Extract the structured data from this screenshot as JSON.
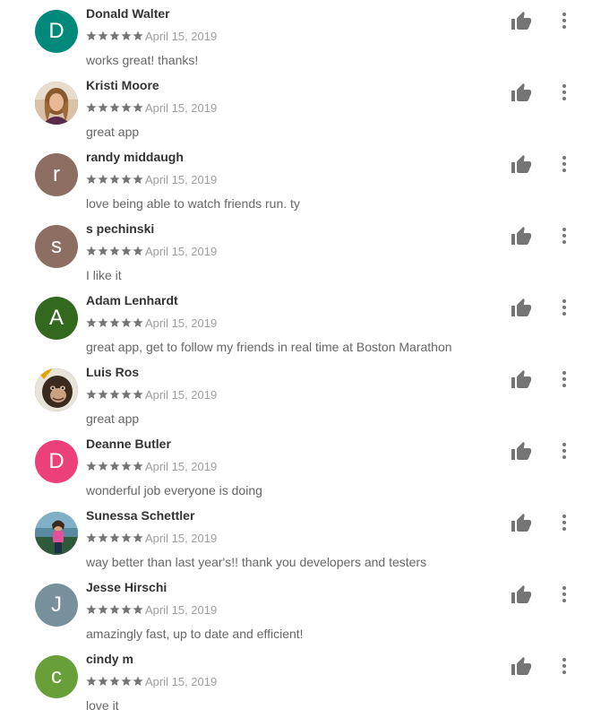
{
  "reviews": [
    {
      "name": "Donald Walter",
      "initial": "D",
      "avatar_color": "#00897b",
      "avatar_type": "initial",
      "date": "April 15, 2019",
      "rating": 5,
      "text": "works great! thanks!"
    },
    {
      "name": "Kristi Moore",
      "initial": "",
      "avatar_color": "#7b4a2d",
      "avatar_type": "photo",
      "date": "April 15, 2019",
      "rating": 5,
      "text": "great app"
    },
    {
      "name": "randy middaugh",
      "initial": "r",
      "avatar_color": "#8d6e63",
      "avatar_type": "initial",
      "date": "April 15, 2019",
      "rating": 5,
      "text": "love being able to watch friends run. ty"
    },
    {
      "name": "s pechinski",
      "initial": "s",
      "avatar_color": "#8d6e63",
      "avatar_type": "initial",
      "date": "April 15, 2019",
      "rating": 5,
      "text": "I like it"
    },
    {
      "name": "Adam Lenhardt",
      "initial": "A",
      "avatar_color": "#33691e",
      "avatar_type": "initial",
      "date": "April 15, 2019",
      "rating": 5,
      "text": "great app, get to follow my friends in real time at Boston Marathon"
    },
    {
      "name": "Luis Ros",
      "initial": "",
      "avatar_color": "#5d4037",
      "avatar_type": "photo",
      "date": "April 15, 2019",
      "rating": 5,
      "text": "great app"
    },
    {
      "name": "Deanne Butler",
      "initial": "D",
      "avatar_color": "#ec407a",
      "avatar_type": "initial",
      "date": "April 15, 2019",
      "rating": 5,
      "text": "wonderful job everyone is doing"
    },
    {
      "name": "Sunessa Schettler",
      "initial": "",
      "avatar_color": "#3f6e8c",
      "avatar_type": "photo",
      "date": "April 15, 2019",
      "rating": 5,
      "text": "way better than last year's!! thank you developers and testers"
    },
    {
      "name": "Jesse Hirschi",
      "initial": "J",
      "avatar_color": "#78909c",
      "avatar_type": "initial",
      "date": "April 15, 2019",
      "rating": 5,
      "text": "amazingly fast, up to date and efficient!"
    },
    {
      "name": "cindy m",
      "initial": "c",
      "avatar_color": "#689f38",
      "avatar_type": "initial",
      "date": "April 15, 2019",
      "rating": 5,
      "text": "love it"
    }
  ],
  "colors": {
    "star": "#757575",
    "icon": "#757575",
    "date": "#9e9e9e"
  },
  "icons": {
    "helpful": "thumbs-up-icon",
    "menu": "more-vertical-icon",
    "star": "star-icon"
  }
}
